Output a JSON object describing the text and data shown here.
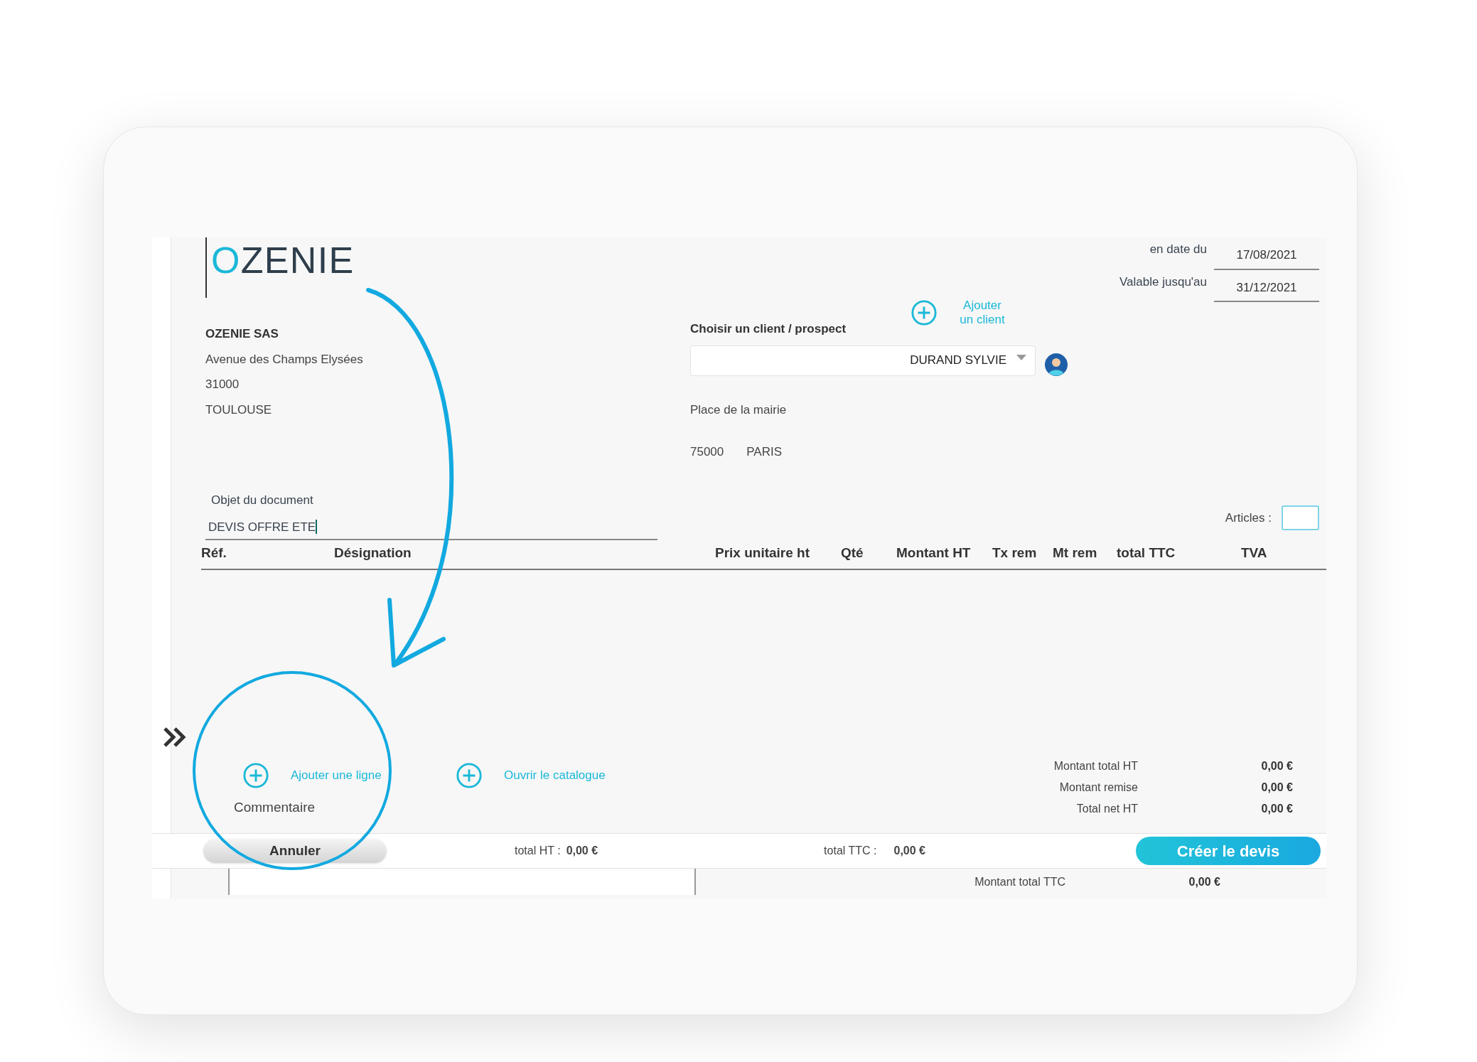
{
  "company": {
    "logo": "OZENIE",
    "name": "OZENIE SAS",
    "address": [
      "Avenue des Champs Elysées",
      "31000",
      "TOULOUSE"
    ]
  },
  "document_subject": {
    "label": "Objet du document",
    "value": "DEVIS OFFRE ETE"
  },
  "client": {
    "add_button": "Ajouter un client",
    "label": "Choisir un client / prospect",
    "selected_client": "DURAND SYLVIE",
    "street": "Place de la mairie",
    "postcode": "75000",
    "city": "PARIS"
  },
  "dates": [
    {
      "label": "en date du",
      "value": "17/08/2021"
    },
    {
      "label": "Valable jusqu'au",
      "value": "31/12/2021"
    }
  ],
  "articles": {
    "label": "Articles :"
  },
  "table": {
    "columns": [
      "Réf.",
      "Désignation",
      "Prix unitaire ht",
      "Qté",
      "Montant HT",
      "Tx rem",
      "Mt rem",
      "total TTC",
      "TVA"
    ]
  },
  "actions": [
    "Ajouter une ligne",
    "Ouvrir le catalogue"
  ],
  "comment_label": "Commentaire",
  "totals": [
    {
      "label": "Montant total HT",
      "value": "0,00 €"
    },
    {
      "label": "Montant remise",
      "value": "0,00 €"
    },
    {
      "label": "Total net HT",
      "value": "0,00 €"
    }
  ],
  "footer_bar": {
    "cancel": "Annuler",
    "total_ht_label": "total HT :",
    "total_ht": "0,00 €",
    "total_ttc_label": "total TTC :",
    "total_ttc": "0,00 €",
    "create": "Créer le devis"
  },
  "total_ttc": {
    "label": "Montant total TTC",
    "value": "0,00 €"
  }
}
